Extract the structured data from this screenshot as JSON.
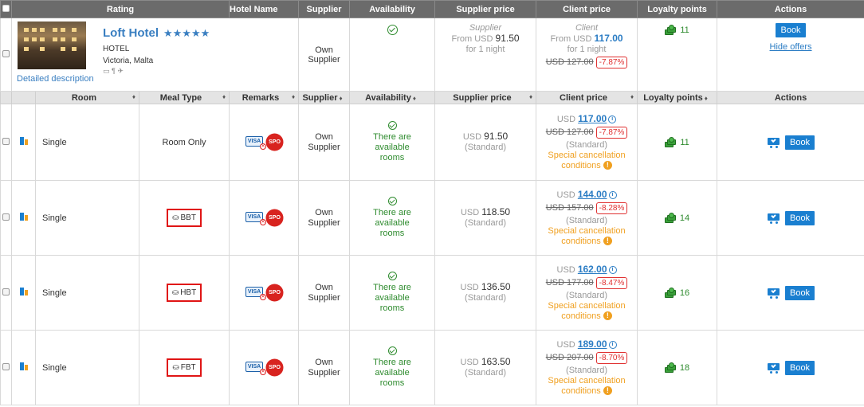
{
  "header": {
    "checkbox": "",
    "rating": "Rating",
    "hotel_name": "Hotel Name",
    "supplier": "Supplier",
    "availability": "Availability",
    "supplier_price": "Supplier price",
    "client_price": "Client price",
    "loyalty_points": "Loyalty points",
    "actions": "Actions"
  },
  "hotel": {
    "name": "Loft Hotel",
    "stars": "★★★★★",
    "type": "HOTEL",
    "location": "Victoria, Malta",
    "facility_icons": "▭ ¶ ✈",
    "detailed_description": "Detailed description",
    "supplier": "Own Supplier",
    "supplier_price_label": "Supplier",
    "supplier_price_from": "From USD",
    "supplier_price_value": "91.50",
    "supplier_price_nights": "for 1 night",
    "client_price_label": "Client",
    "client_price_from": "From USD",
    "client_price_value": "117.00",
    "client_price_nights": "for 1 night",
    "client_price_old": "USD 127.00",
    "client_price_discount": "-7.87%",
    "loyalty": "11",
    "book_label": "Book",
    "hide_offers": "Hide offers"
  },
  "room_header": {
    "room": "Room",
    "meal_type": "Meal Type",
    "remarks": "Remarks",
    "supplier": "Supplier",
    "availability": "Availability",
    "supplier_price": "Supplier price",
    "client_price": "Client price",
    "loyalty_points": "Loyalty points",
    "actions": "Actions",
    "sort_glyph": "♦"
  },
  "rooms": [
    {
      "room": "Single",
      "meal": "Room Only",
      "meal_boxed": false,
      "supplier_line1": "Own",
      "supplier_line2": "Supplier",
      "avail1": "There are",
      "avail2": "available",
      "avail3": "rooms",
      "supplier_price": "USD 91.50",
      "supplier_price_currency": "USD",
      "supplier_price_value": "91.50",
      "standard": "(Standard)",
      "client_currency": "USD",
      "client_value": "117.00",
      "client_old": "USD 127.00",
      "client_discount": "-7.87%",
      "cancel1": "Special cancellation",
      "cancel2": "conditions",
      "loyalty": "11",
      "book": "Book"
    },
    {
      "room": "Single",
      "meal": "BBT",
      "meal_boxed": true,
      "supplier_line1": "Own",
      "supplier_line2": "Supplier",
      "avail1": "There are",
      "avail2": "available",
      "avail3": "rooms",
      "supplier_price_currency": "USD",
      "supplier_price_value": "118.50",
      "standard": "(Standard)",
      "client_currency": "USD",
      "client_value": "144.00",
      "client_old": "USD 157.00",
      "client_discount": "-8.28%",
      "cancel1": "Special cancellation",
      "cancel2": "conditions",
      "loyalty": "14",
      "book": "Book"
    },
    {
      "room": "Single",
      "meal": "HBT",
      "meal_boxed": true,
      "supplier_line1": "Own",
      "supplier_line2": "Supplier",
      "avail1": "There are",
      "avail2": "available",
      "avail3": "rooms",
      "supplier_price_currency": "USD",
      "supplier_price_value": "136.50",
      "standard": "(Standard)",
      "client_currency": "USD",
      "client_value": "162.00",
      "client_old": "USD 177.00",
      "client_discount": "-8.47%",
      "cancel1": "Special cancellation",
      "cancel2": "conditions",
      "loyalty": "16",
      "book": "Book"
    },
    {
      "room": "Single",
      "meal": "FBT",
      "meal_boxed": true,
      "supplier_line1": "Own",
      "supplier_line2": "Supplier",
      "avail1": "There are",
      "avail2": "available",
      "avail3": "rooms",
      "supplier_price_currency": "USD",
      "supplier_price_value": "163.50",
      "standard": "(Standard)",
      "client_currency": "USD",
      "client_value": "189.00",
      "client_old": "USD 207.00",
      "client_discount": "-8.70%",
      "cancel1": "Special cancellation",
      "cancel2": "conditions",
      "loyalty": "18",
      "book": "Book"
    }
  ],
  "icons": {
    "visa": "VISA",
    "visa_x": "✕",
    "spo": "SPO",
    "info": "i",
    "warn": "!",
    "dish": "⛀"
  },
  "colors": {
    "header_bg": "#6b6b6b",
    "link_blue": "#2a7cc4",
    "available_green": "#2e8b2e",
    "discount_red": "#e03030",
    "cancel_orange": "#f0a020",
    "book_blue": "#1a7fd0"
  }
}
